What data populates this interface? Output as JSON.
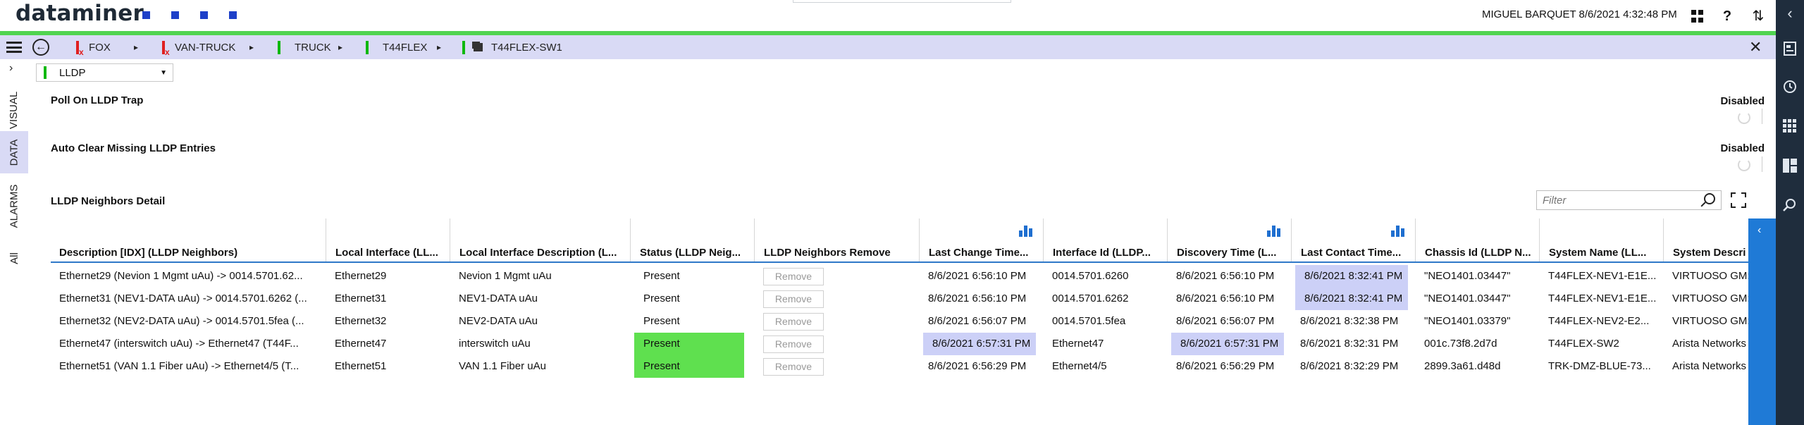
{
  "app": {
    "logo": "dataminer",
    "user_info": "MIGUEL BARQUET 8/6/2021 4:32:48 PM",
    "icons": [
      "apps-grid-icon",
      "help-icon",
      "sort-arrows-icon"
    ],
    "help_glyph": "?",
    "sort_glyph": "⇅",
    "accent_color": "#50d450",
    "brand_square_color": "#1e40c8"
  },
  "breadcrumb": {
    "items": [
      {
        "label": "FOX",
        "status": "error"
      },
      {
        "label": "VAN-TRUCK",
        "status": "error"
      },
      {
        "label": "TRUCK",
        "status": "ok"
      },
      {
        "label": "T44FLEX",
        "status": "ok"
      },
      {
        "label": "T44FLEX-SW1",
        "status": "element"
      }
    ],
    "separator": "▸",
    "close_glyph": "✕",
    "back_glyph": "←"
  },
  "left_tabs": {
    "collapse_glyph": "›",
    "tabs": [
      {
        "label": "VISUAL",
        "active": false
      },
      {
        "label": "DATA",
        "active": true
      },
      {
        "label": "ALARMS",
        "active": false
      },
      {
        "label": "All",
        "active": false
      }
    ]
  },
  "right_sidebar": {
    "icons": [
      "collapse-chevron-icon",
      "card-icon",
      "history-icon",
      "apps-icon",
      "dashboard-icon",
      "search-icon"
    ],
    "chevron_glyph": "‹"
  },
  "page": {
    "selector": {
      "value": "LLDP",
      "caret": "▼"
    },
    "params": [
      {
        "label": "Poll On LLDP Trap",
        "value": "Disabled"
      },
      {
        "label": "Auto Clear Missing LLDP Entries",
        "value": "Disabled"
      }
    ],
    "table_title": "LLDP Neighbors Detail",
    "filter_placeholder": "Filter"
  },
  "table": {
    "columns": [
      {
        "label": "Description [IDX] (LLDP Neighbors)",
        "trend": false
      },
      {
        "label": "Local Interface (LL...",
        "trend": false
      },
      {
        "label": "Local Interface Description (L...",
        "trend": false
      },
      {
        "label": "Status (LLDP Neig...",
        "trend": false
      },
      {
        "label": "LLDP Neighbors Remove",
        "trend": false
      },
      {
        "label": "Last Change Time...",
        "trend": true
      },
      {
        "label": "Interface Id (LLDP...",
        "trend": false
      },
      {
        "label": "Discovery Time (L...",
        "trend": true
      },
      {
        "label": "Last Contact Time...",
        "trend": true
      },
      {
        "label": "Chassis Id (LLDP N...",
        "trend": false
      },
      {
        "label": "System Name (LL...",
        "trend": false
      },
      {
        "label": "System Descri",
        "trend": false
      }
    ],
    "remove_label": "Remove",
    "rows": [
      {
        "cells": [
          "Ethernet29 (Nevion 1 Mgmt uAu) -> 0014.5701.62...",
          "Ethernet29",
          "Nevion 1 Mgmt uAu",
          "Present",
          "",
          "8/6/2021 6:56:10 PM",
          "0014.5701.6260",
          "8/6/2021 6:56:10 PM",
          "8/6/2021 8:32:41 PM",
          "\"NEO1401.03447\"",
          "T44FLEX-NEV1-E1E...",
          "VIRTUOSO GM:"
        ],
        "highlight": [
          8
        ],
        "status_alarm": false
      },
      {
        "cells": [
          "Ethernet31 (NEV1-DATA uAu) -> 0014.5701.6262 (...",
          "Ethernet31",
          "NEV1-DATA uAu",
          "Present",
          "",
          "8/6/2021 6:56:10 PM",
          "0014.5701.6262",
          "8/6/2021 6:56:10 PM",
          "8/6/2021 8:32:41 PM",
          "\"NEO1401.03447\"",
          "T44FLEX-NEV1-E1E...",
          "VIRTUOSO GM:"
        ],
        "highlight": [
          8
        ],
        "status_alarm": false
      },
      {
        "cells": [
          "Ethernet32 (NEV2-DATA uAu) -> 0014.5701.5fea (...",
          "Ethernet32",
          "NEV2-DATA uAu",
          "Present",
          "",
          "8/6/2021 6:56:07 PM",
          "0014.5701.5fea",
          "8/6/2021 6:56:07 PM",
          "8/6/2021 8:32:38 PM",
          "\"NEO1401.03379\"",
          "T44FLEX-NEV2-E2...",
          "VIRTUOSO GM:"
        ],
        "highlight": [],
        "status_alarm": false
      },
      {
        "cells": [
          "Ethernet47 (interswitch uAu) -> Ethernet47 (T44F...",
          "Ethernet47",
          "interswitch uAu",
          "Present",
          "",
          "8/6/2021 6:57:31 PM",
          "Ethernet47",
          "8/6/2021 6:57:31 PM",
          "8/6/2021 8:32:31 PM",
          "001c.73f8.2d7d",
          "T44FLEX-SW2",
          "Arista Networks"
        ],
        "highlight": [
          5,
          7
        ],
        "status_alarm": true
      },
      {
        "cells": [
          "Ethernet51 (VAN 1.1 Fiber uAu) -> Ethernet4/5 (T...",
          "Ethernet51",
          "VAN 1.1 Fiber uAu",
          "Present",
          "",
          "8/6/2021 6:56:29 PM",
          "Ethernet4/5",
          "8/6/2021 6:56:29 PM",
          "8/6/2021 8:32:29 PM",
          "2899.3a61.d48d",
          "TRK-DMZ-BLUE-73...",
          "Arista Networks"
        ],
        "highlight": [],
        "status_alarm": true
      }
    ]
  },
  "scrollbar": {
    "glyph": "‹"
  }
}
